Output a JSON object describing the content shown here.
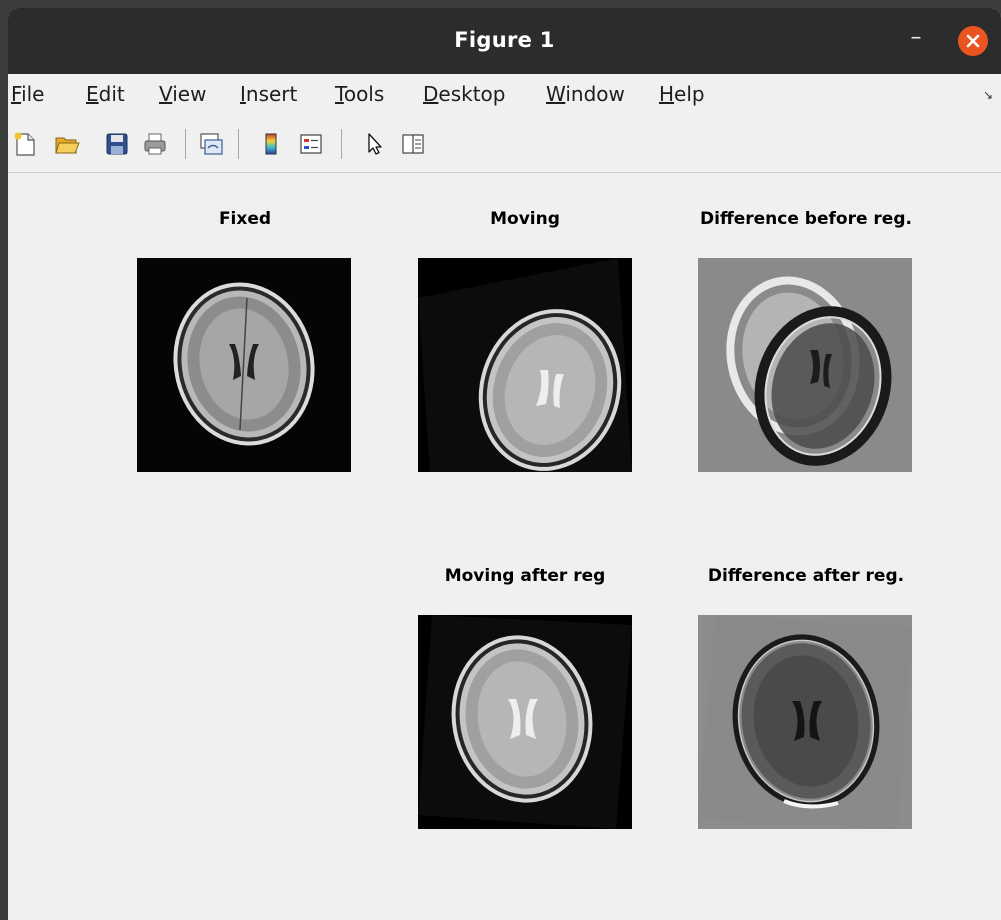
{
  "window": {
    "title": "Figure 1"
  },
  "menubar": {
    "items": [
      {
        "mnemonic": "F",
        "rest": "ile"
      },
      {
        "mnemonic": "E",
        "rest": "dit"
      },
      {
        "mnemonic": "V",
        "rest": "iew"
      },
      {
        "mnemonic": "I",
        "rest": "nsert"
      },
      {
        "mnemonic": "T",
        "rest": "ools"
      },
      {
        "mnemonic": "D",
        "rest": "esktop"
      },
      {
        "mnemonic": "W",
        "rest": "indow"
      },
      {
        "mnemonic": "H",
        "rest": "elp"
      }
    ]
  },
  "toolbar": {
    "buttons": [
      "new-figure-icon",
      "open-file-icon",
      "save-icon",
      "print-icon",
      "link-plot-icon",
      "colorbar-icon",
      "legend-icon",
      "pointer-icon",
      "property-inspector-icon"
    ]
  },
  "figure": {
    "panels": [
      {
        "title": "Fixed"
      },
      {
        "title": "Moving"
      },
      {
        "title": "Difference before reg."
      },
      {
        "title": "Moving after reg"
      },
      {
        "title": "Difference after reg."
      }
    ]
  },
  "colors": {
    "titlebar": "#2c2c2c",
    "close_button": "#e95420",
    "background": "#f0f0f0"
  }
}
